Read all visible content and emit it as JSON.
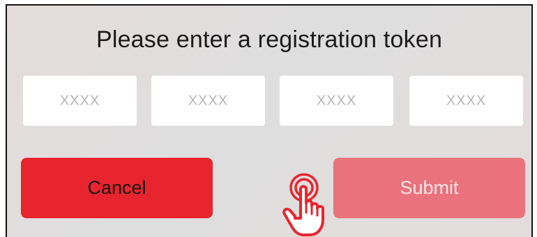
{
  "dialog": {
    "title": "Please enter a registration token",
    "token_fields": [
      {
        "placeholder": "XXXX",
        "value": ""
      },
      {
        "placeholder": "XXXX",
        "value": ""
      },
      {
        "placeholder": "XXXX",
        "value": ""
      },
      {
        "placeholder": "XXXX",
        "value": ""
      }
    ],
    "cancel_label": "Cancel",
    "submit_label": "Submit",
    "submit_state": "disabled"
  },
  "colors": {
    "cancel_bg": "#e8252f",
    "submit_bg": "#e9727c",
    "pointer": "#e8252f"
  },
  "overlay": {
    "icon": "tap-hand-icon"
  }
}
